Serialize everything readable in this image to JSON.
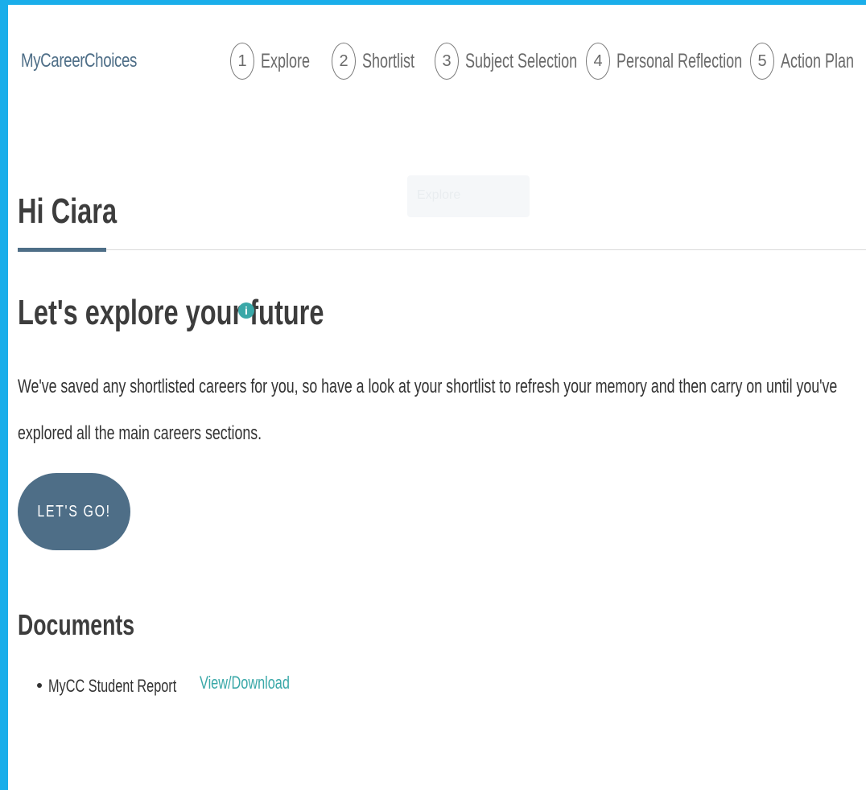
{
  "brand": {
    "name": "MyCareerChoices",
    "accent": "#4e6e87",
    "link_color": "#3aa8a8",
    "frame_color": "#1aaeea"
  },
  "steps": [
    {
      "num": "1",
      "label": "Explore"
    },
    {
      "num": "2",
      "label": "Shortlist"
    },
    {
      "num": "3",
      "label": "Subject Selection"
    },
    {
      "num": "4",
      "label": "Personal Reflection"
    },
    {
      "num": "5",
      "label": "Action Plan"
    }
  ],
  "greeting": "Hi Ciara",
  "ghost_tab": "Explore",
  "section": {
    "title": "Let's explore your future",
    "info_icon": "info-icon",
    "intro": "We've saved any shortlisted careers for you, so have a look at your shortlist to refresh your memory and then carry on until you've explored all the main careers sections.",
    "cta": "LET'S GO!"
  },
  "documents": {
    "title": "Documents",
    "items": [
      {
        "name": "MyCC Student Report",
        "link": "View/Download"
      }
    ]
  }
}
